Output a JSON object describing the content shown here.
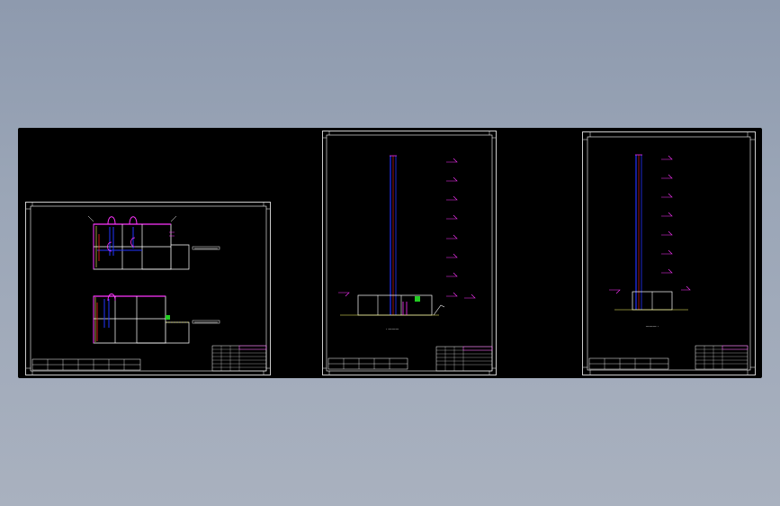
{
  "app": {
    "viewport_background": "#000000",
    "desktop_gradient": [
      "#8e9aae",
      "#a9b1bf"
    ]
  },
  "colors": {
    "sheet_border": "#ffffff",
    "wall": "#ffffff",
    "pipe_magenta": "#ff33ff",
    "pipe_blue": "#2233ff",
    "pipe_red": "#ff2222",
    "pipe_yellow": "#ffff66",
    "pipe_green": "#22cc22",
    "title_block": "#ffffff"
  },
  "sheets": [
    {
      "name": "plan-sheet",
      "kind": "floor-plans"
    },
    {
      "name": "riser-sheet-1",
      "kind": "riser-elevation"
    },
    {
      "name": "riser-sheet-2",
      "kind": "riser-elevation"
    }
  ]
}
